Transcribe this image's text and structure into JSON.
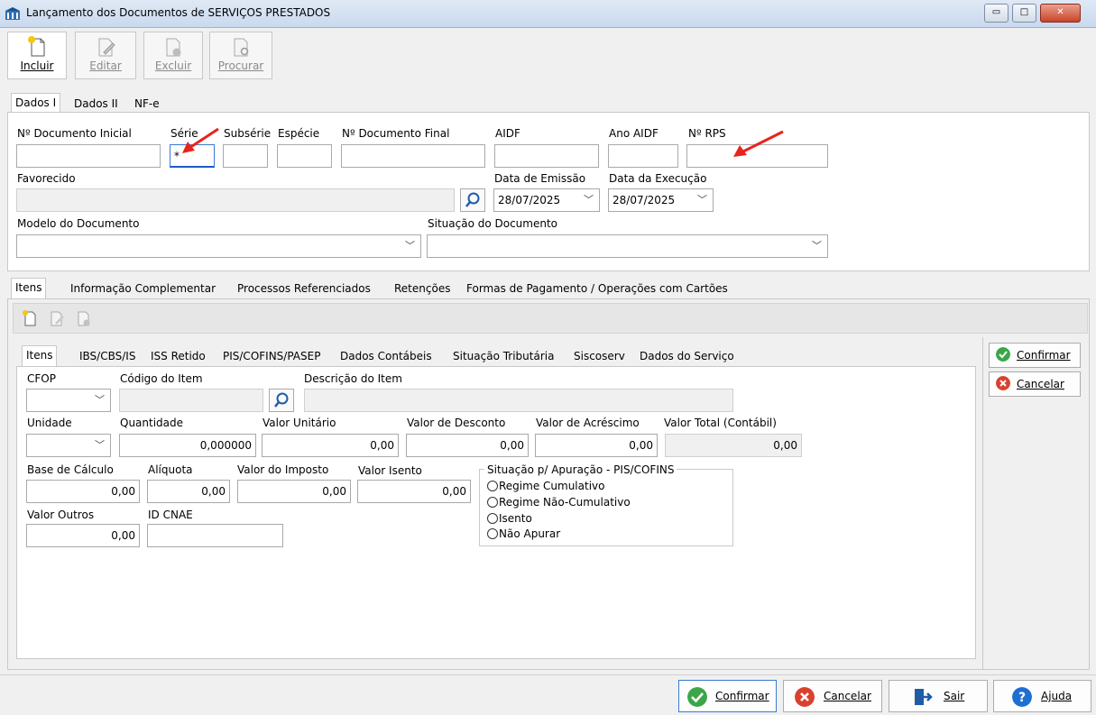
{
  "window": {
    "title": "Lançamento dos Documentos de SERVIÇOS PRESTADOS",
    "controls": {
      "minimize": "▭",
      "maximize": "□",
      "close": "✕"
    }
  },
  "toolbar": {
    "incluir": "Incluir",
    "editar": "Editar",
    "excluir": "Excluir",
    "procurar": "Procurar"
  },
  "header_tabs": [
    "Dados I",
    "Dados II",
    "NF-e"
  ],
  "dados1": {
    "n_doc_inicial_label": "Nº Documento Inicial",
    "n_doc_inicial_value": "",
    "serie_label": "Série",
    "serie_value": "*",
    "subserie_label": "Subsérie",
    "especie_label": "Espécie",
    "n_doc_final_label": "Nº Documento Final",
    "aidf_label": "AIDF",
    "ano_aidf_label": "Ano AIDF",
    "n_rps_label": "Nº RPS",
    "favorecido_label": "Favorecido",
    "data_emissao_label": "Data de Emissão",
    "data_emissao_value": "28/07/2025",
    "data_execucao_label": "Data da Execução",
    "data_execucao_value": "28/07/2025",
    "modelo_label": "Modelo do Documento",
    "situacao_label": "Situação do Documento"
  },
  "detail_tabs": [
    "Itens",
    "Informação Complementar",
    "Processos Referenciados",
    "Retenções",
    "Formas de Pagamento / Operações com Cartões"
  ],
  "item_tabs": [
    "Itens",
    "IBS/CBS/IS",
    "ISS Retido",
    "PIS/COFINS/PASEP",
    "Dados Contábeis",
    "Situação Tributária",
    "Siscoserv",
    "Dados do Serviço"
  ],
  "item": {
    "cfop_label": "CFOP",
    "codigo_label": "Código do Item",
    "descricao_label": "Descrição do Item",
    "unidade_label": "Unidade",
    "quantidade_label": "Quantidade",
    "quantidade_value": "0,000000",
    "valor_unitario_label": "Valor Unitário",
    "valor_unitario_value": "0,00",
    "valor_desconto_label": "Valor de Desconto",
    "valor_desconto_value": "0,00",
    "valor_acrescimo_label": "Valor de Acréscimo",
    "valor_acrescimo_value": "0,00",
    "valor_total_label": "Valor Total (Contábil)",
    "valor_total_value": "0,00",
    "base_calculo_label": "Base de Cálculo",
    "base_calculo_value": "0,00",
    "aliquota_label": "Alíquota",
    "aliquota_value": "0,00",
    "valor_imposto_label": "Valor do Imposto",
    "valor_imposto_value": "0,00",
    "valor_isento_label": "Valor Isento",
    "valor_isento_value": "0,00",
    "valor_outros_label": "Valor Outros",
    "valor_outros_value": "0,00",
    "id_cnae_label": "ID CNAE",
    "situacao_group_label": "Situação p/ Apuração - PIS/COFINS",
    "situacao_options": [
      "Regime Cumulativo",
      "Regime Não-Cumulativo",
      "Isento",
      "Não Apurar"
    ]
  },
  "side_buttons": {
    "confirmar": "Confirmar",
    "cancelar": "Cancelar"
  },
  "footer": {
    "confirmar": "Confirmar",
    "cancelar": "Cancelar",
    "sair": "Sair",
    "ajuda": "Ajuda"
  },
  "colors": {
    "confirm_green": "#3aa648",
    "cancel_red": "#d9412e",
    "help_blue": "#1f6fd1",
    "annotation_red": "#e8241c"
  }
}
